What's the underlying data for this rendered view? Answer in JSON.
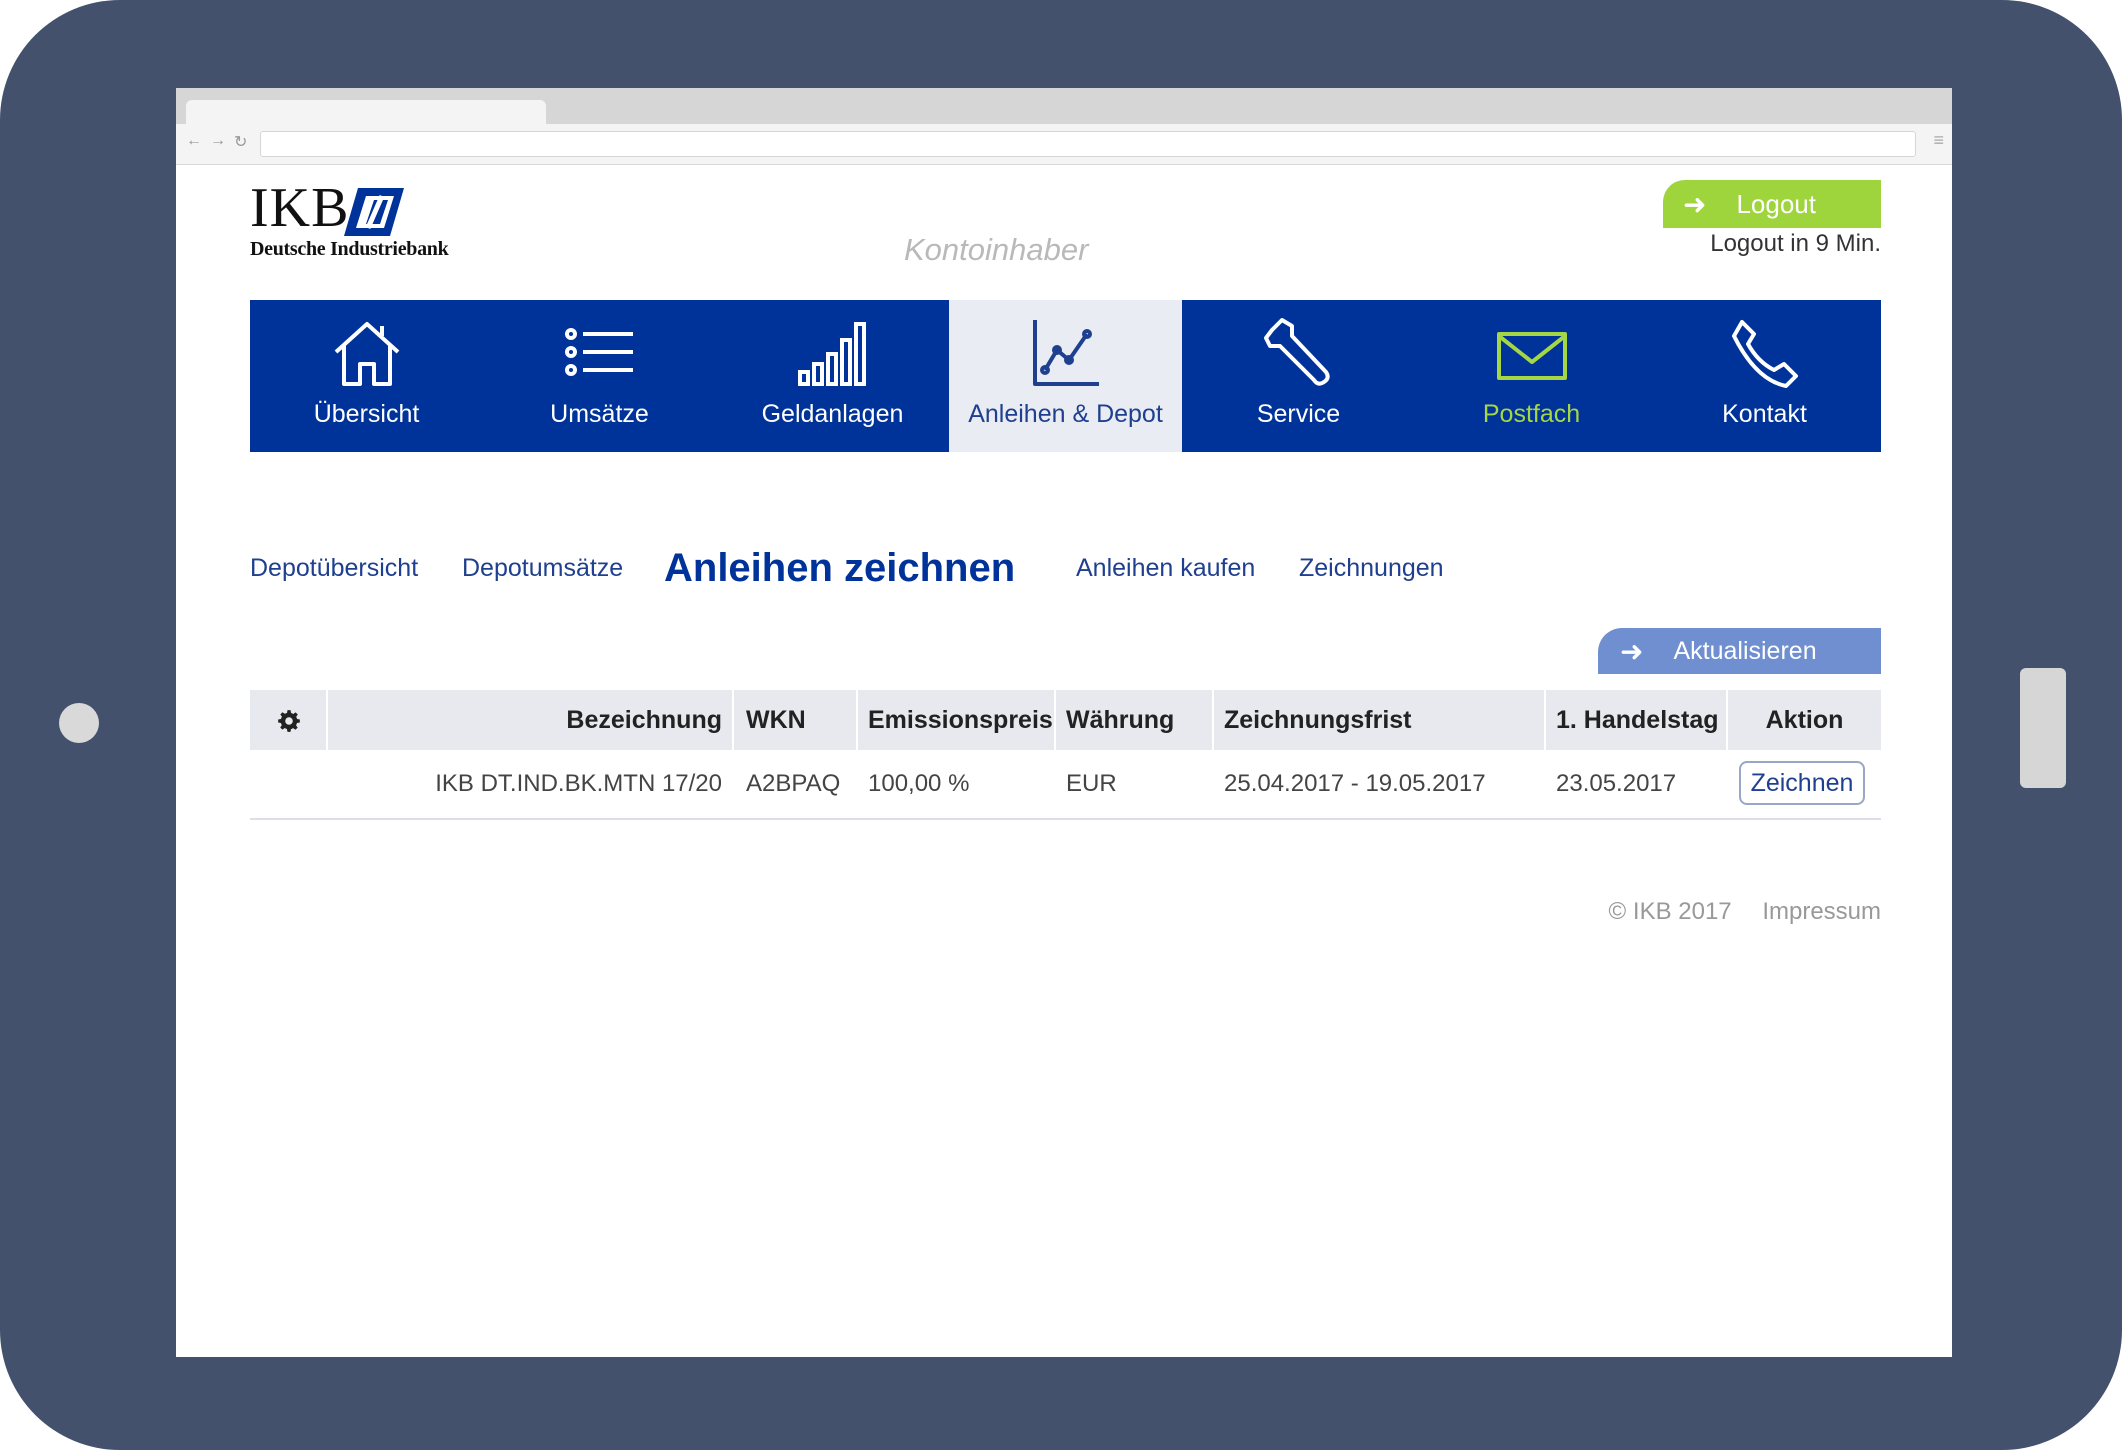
{
  "logo": {
    "brand": "IKB",
    "subtitle": "Deutsche Industriebank"
  },
  "header": {
    "account_holder": "Kontoinhaber",
    "logout_label": "Logout",
    "logout_timer": "Logout in 9 Min."
  },
  "nav": {
    "items": [
      {
        "label": "Übersicht",
        "icon": "home-icon"
      },
      {
        "label": "Umsätze",
        "icon": "list-icon"
      },
      {
        "label": "Geldanlagen",
        "icon": "signal-bars-icon"
      },
      {
        "label": "Anleihen & Depot",
        "icon": "chart-line-icon",
        "active": true
      },
      {
        "label": "Service",
        "icon": "wrench-icon"
      },
      {
        "label": "Postfach",
        "icon": "envelope-icon"
      },
      {
        "label": "Kontakt",
        "icon": "phone-icon"
      }
    ]
  },
  "subnav": {
    "items": [
      {
        "label": "Depotübersicht"
      },
      {
        "label": "Depotumsätze"
      },
      {
        "label": "Anleihen zeichnen",
        "active": true
      },
      {
        "label": "Anleihen kaufen"
      },
      {
        "label": "Zeichnungen"
      }
    ]
  },
  "refresh_label": "Aktualisieren",
  "table": {
    "headers": [
      "Bezeichnung",
      "WKN",
      "Emissionspreis",
      "Währung",
      "Zeichnungsfrist",
      "1. Handelstag",
      "Aktion"
    ],
    "rows": [
      {
        "name": "IKB DT.IND.BK.MTN 17/20",
        "wkn": "A2BPAQ",
        "price": "100,00 %",
        "currency": "EUR",
        "period": "25.04.2017 - 19.05.2017",
        "first_trading_day": "23.05.2017",
        "action": "Zeichnen"
      }
    ]
  },
  "footer": {
    "copyright": "© IKB 2017",
    "imprint": "Impressum"
  },
  "colors": {
    "nav_blue": "#003399",
    "logout_green": "#9ed43c",
    "refresh_blue": "#6f8fd0"
  }
}
